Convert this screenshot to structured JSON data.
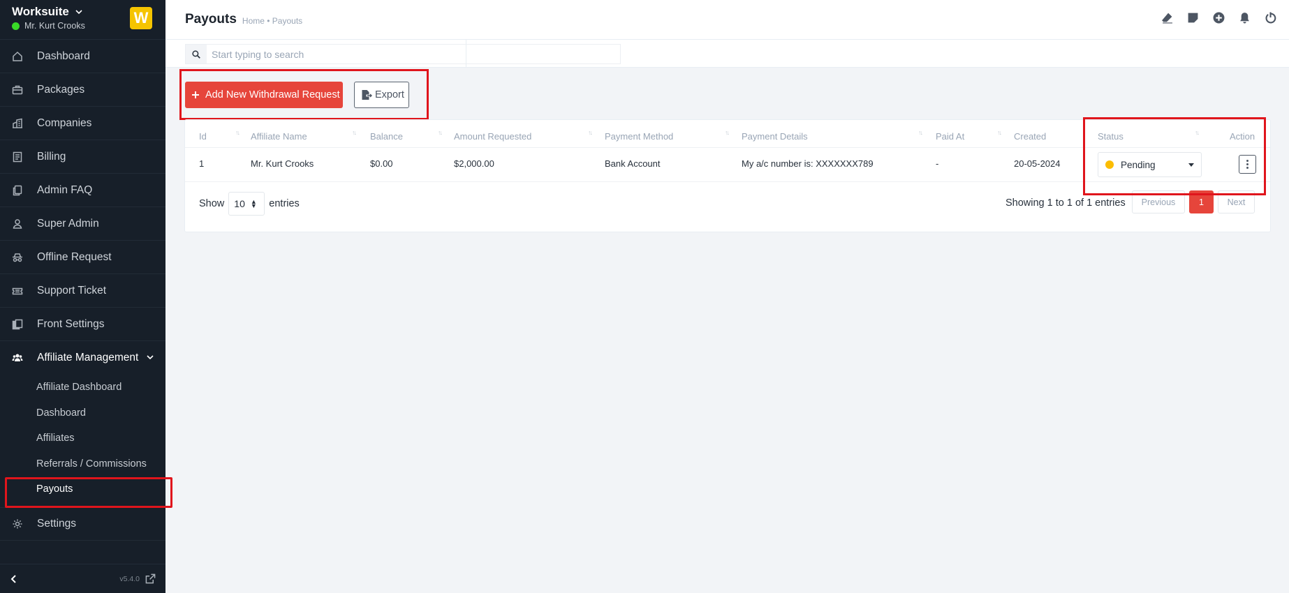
{
  "brand": {
    "name": "Worksuite",
    "user": "Mr. Kurt Crooks",
    "logo_letter": "W"
  },
  "sidebar": {
    "items": [
      {
        "label": "Dashboard",
        "icon": "house-icon"
      },
      {
        "label": "Packages",
        "icon": "briefcase-icon"
      },
      {
        "label": "Companies",
        "icon": "building-icon"
      },
      {
        "label": "Billing",
        "icon": "receipt-icon"
      },
      {
        "label": "Admin FAQ",
        "icon": "copy-icon"
      },
      {
        "label": "Super Admin",
        "icon": "person-icon"
      },
      {
        "label": "Offline Request",
        "icon": "incognito-icon"
      },
      {
        "label": "Support Ticket",
        "icon": "ticket-icon"
      },
      {
        "label": "Front Settings",
        "icon": "files-icon"
      }
    ],
    "active_group": {
      "label": "Affiliate Management",
      "icon": "people-icon"
    },
    "sub_items": [
      {
        "label": "Affiliate Dashboard"
      },
      {
        "label": "Dashboard"
      },
      {
        "label": "Affiliates"
      },
      {
        "label": "Referrals / Commissions"
      },
      {
        "label": "Payouts"
      }
    ],
    "settings": {
      "label": "Settings",
      "icon": "gear-icon"
    },
    "version": "v5.4.0"
  },
  "header": {
    "title": "Payouts",
    "breadcrumb": "Home • Payouts"
  },
  "search": {
    "placeholder": "Start typing to search",
    "value": ""
  },
  "toolbar": {
    "add_label": "Add New Withdrawal Request",
    "export_label": "Export"
  },
  "table": {
    "columns": [
      "Id",
      "Affiliate Name",
      "Balance",
      "Amount Requested",
      "Payment Method",
      "Payment Details",
      "Paid At",
      "Created",
      "Status",
      "Action"
    ],
    "rows": [
      {
        "id": "1",
        "affiliate_name": "Mr. Kurt Crooks",
        "balance": "$0.00",
        "amount_requested": "$2,000.00",
        "payment_method": "Bank Account",
        "payment_details": "My a/c number is: XXXXXXX789",
        "paid_at": "-",
        "created": "20-05-2024",
        "status": "Pending",
        "status_color": "#fcbd01"
      }
    ]
  },
  "footer": {
    "show_label": "Show",
    "page_length": "10",
    "entries_label": "entries",
    "info": "Showing 1 to 1 of 1 entries",
    "previous": "Previous",
    "current_page": "1",
    "next": "Next"
  },
  "colors": {
    "accent": "#e6453b",
    "sidebar_bg": "#171f29",
    "highlight": "#e0151c"
  }
}
